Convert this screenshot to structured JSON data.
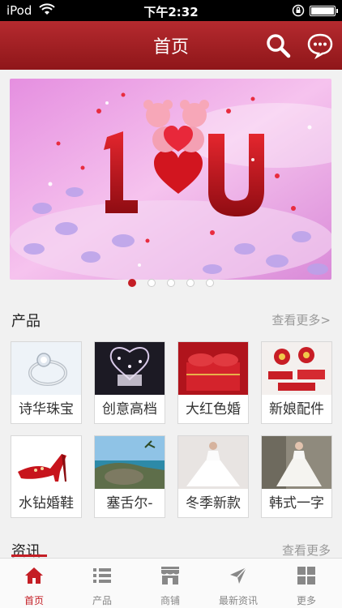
{
  "status_bar": {
    "carrier": "iPod",
    "time": "下午2:32"
  },
  "header": {
    "title": "首页"
  },
  "products": {
    "label": "产品",
    "more": "查看更多>",
    "items": [
      {
        "caption": "诗华珠宝"
      },
      {
        "caption": "创意高档"
      },
      {
        "caption": "大红色婚"
      },
      {
        "caption": "新娘配件"
      },
      {
        "caption": "水钻婚鞋"
      },
      {
        "caption": "塞舌尔-"
      },
      {
        "caption": "冬季新款"
      },
      {
        "caption": "韩式一字"
      }
    ]
  },
  "news": {
    "label": "资讯",
    "more": "查看更多"
  },
  "tabbar": {
    "tabs": [
      {
        "label": "首页"
      },
      {
        "label": "产品"
      },
      {
        "label": "商铺"
      },
      {
        "label": "最新资讯"
      },
      {
        "label": "更多"
      }
    ]
  },
  "colors": {
    "accent": "#c41e25",
    "header": "#a11f24"
  }
}
